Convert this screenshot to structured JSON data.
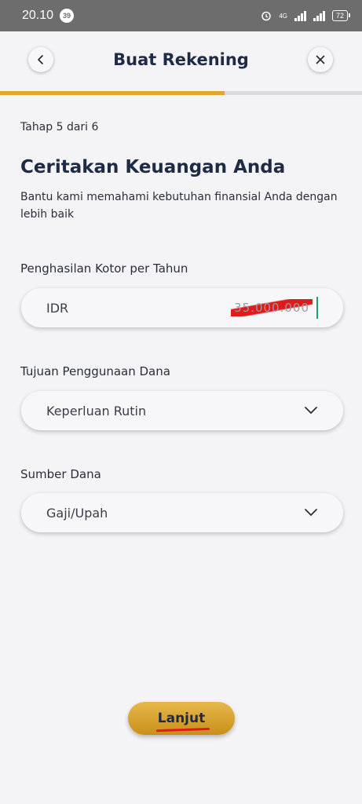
{
  "status_bar": {
    "time": "20.10",
    "notification_count": "39",
    "network_label": "4G",
    "battery": "72"
  },
  "header": {
    "title": "Buat Rekening",
    "back_icon": "chevron-left-icon",
    "close_icon": "close-icon"
  },
  "progress": {
    "current_step": 5,
    "total_steps": 6,
    "fraction": 0.62,
    "fill_color": "#e0a72c"
  },
  "content": {
    "step_text": "Tahap 5 dari 6",
    "heading": "Ceritakan Keuangan Anda",
    "subtitle": "Bantu kami memahami kebutuhan finansial Anda dengan lebih baik"
  },
  "form": {
    "income": {
      "label": "Penghasilan Kotor per Tahun",
      "currency": "IDR",
      "value": "35.000.000"
    },
    "purpose": {
      "label": "Tujuan Penggunaan Dana",
      "selected": "Keperluan Rutin",
      "icon": "chevron-down-icon"
    },
    "source": {
      "label": "Sumber Dana",
      "selected": "Gaji/Upah",
      "icon": "chevron-down-icon"
    }
  },
  "actions": {
    "continue_label": "Lanjut"
  },
  "colors": {
    "accent": "#e0a72c",
    "title": "#1f2a44",
    "background": "#f4f4f6"
  }
}
